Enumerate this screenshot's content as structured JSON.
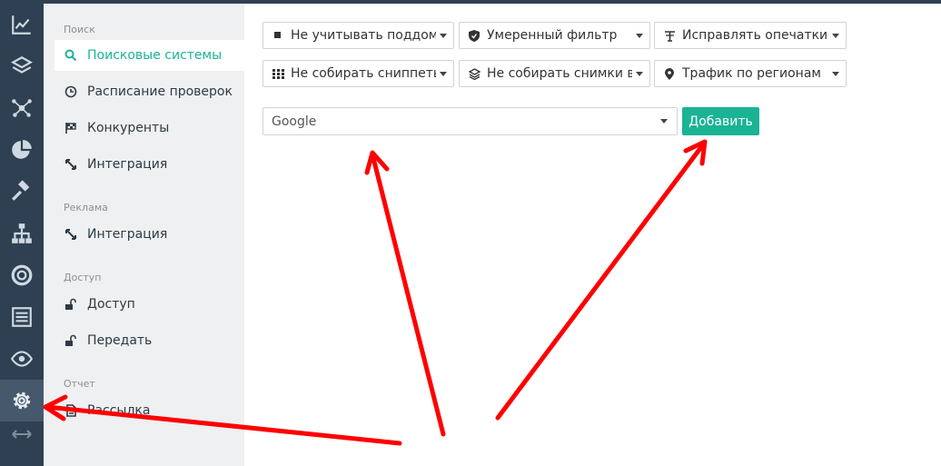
{
  "sidebar": {
    "icons": [
      "chart-icon",
      "layers-icon",
      "network-icon",
      "pie-chart-icon",
      "gavel-icon",
      "sitemap-icon",
      "lifebuoy-icon",
      "report-icon",
      "eye-icon",
      "gear-icon"
    ],
    "active_icon": "gear-icon",
    "expand_icon": "arrows-horizontal-icon"
  },
  "subnav": {
    "search_title": "Поиск",
    "search_items": [
      "Поисковые системы",
      "Расписание проверок",
      "Конкуренты",
      "Интеграция"
    ],
    "ads_title": "Реклама",
    "ads_items": [
      "Интеграция"
    ],
    "access_title": "Доступ",
    "access_items": [
      "Доступ",
      "Передать"
    ],
    "report_title": "Отчет",
    "report_items": [
      "Рассылка"
    ]
  },
  "filters": {
    "subdomains": "Не учитывать поддомены",
    "safe_filter": "Умеренный фильтр",
    "typos": "Исправлять опечатки",
    "snippets": "Не собирать сниппеты",
    "screenshots": "Не собирать снимки выдачи",
    "regions": "Трафик по регионам"
  },
  "engine_select": {
    "value": "Google"
  },
  "add_button": "Добавить",
  "colors": {
    "accent": "#1ab394",
    "rail": "#2e4052",
    "annotation": "#ff0000"
  }
}
